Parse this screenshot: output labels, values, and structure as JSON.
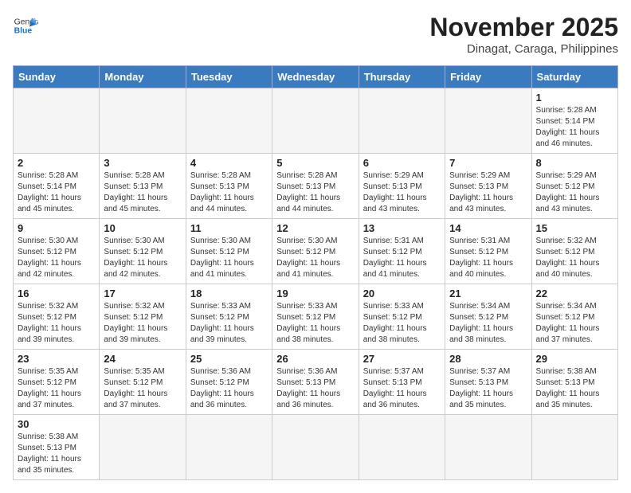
{
  "header": {
    "logo_general": "General",
    "logo_blue": "Blue",
    "month_title": "November 2025",
    "location": "Dinagat, Caraga, Philippines"
  },
  "weekdays": [
    "Sunday",
    "Monday",
    "Tuesday",
    "Wednesday",
    "Thursday",
    "Friday",
    "Saturday"
  ],
  "weeks": [
    [
      {
        "day": "",
        "info": ""
      },
      {
        "day": "",
        "info": ""
      },
      {
        "day": "",
        "info": ""
      },
      {
        "day": "",
        "info": ""
      },
      {
        "day": "",
        "info": ""
      },
      {
        "day": "",
        "info": ""
      },
      {
        "day": "1",
        "info": "Sunrise: 5:28 AM\nSunset: 5:14 PM\nDaylight: 11 hours\nand 46 minutes."
      }
    ],
    [
      {
        "day": "2",
        "info": "Sunrise: 5:28 AM\nSunset: 5:14 PM\nDaylight: 11 hours\nand 45 minutes."
      },
      {
        "day": "3",
        "info": "Sunrise: 5:28 AM\nSunset: 5:13 PM\nDaylight: 11 hours\nand 45 minutes."
      },
      {
        "day": "4",
        "info": "Sunrise: 5:28 AM\nSunset: 5:13 PM\nDaylight: 11 hours\nand 44 minutes."
      },
      {
        "day": "5",
        "info": "Sunrise: 5:28 AM\nSunset: 5:13 PM\nDaylight: 11 hours\nand 44 minutes."
      },
      {
        "day": "6",
        "info": "Sunrise: 5:29 AM\nSunset: 5:13 PM\nDaylight: 11 hours\nand 43 minutes."
      },
      {
        "day": "7",
        "info": "Sunrise: 5:29 AM\nSunset: 5:13 PM\nDaylight: 11 hours\nand 43 minutes."
      },
      {
        "day": "8",
        "info": "Sunrise: 5:29 AM\nSunset: 5:12 PM\nDaylight: 11 hours\nand 43 minutes."
      }
    ],
    [
      {
        "day": "9",
        "info": "Sunrise: 5:30 AM\nSunset: 5:12 PM\nDaylight: 11 hours\nand 42 minutes."
      },
      {
        "day": "10",
        "info": "Sunrise: 5:30 AM\nSunset: 5:12 PM\nDaylight: 11 hours\nand 42 minutes."
      },
      {
        "day": "11",
        "info": "Sunrise: 5:30 AM\nSunset: 5:12 PM\nDaylight: 11 hours\nand 41 minutes."
      },
      {
        "day": "12",
        "info": "Sunrise: 5:30 AM\nSunset: 5:12 PM\nDaylight: 11 hours\nand 41 minutes."
      },
      {
        "day": "13",
        "info": "Sunrise: 5:31 AM\nSunset: 5:12 PM\nDaylight: 11 hours\nand 41 minutes."
      },
      {
        "day": "14",
        "info": "Sunrise: 5:31 AM\nSunset: 5:12 PM\nDaylight: 11 hours\nand 40 minutes."
      },
      {
        "day": "15",
        "info": "Sunrise: 5:32 AM\nSunset: 5:12 PM\nDaylight: 11 hours\nand 40 minutes."
      }
    ],
    [
      {
        "day": "16",
        "info": "Sunrise: 5:32 AM\nSunset: 5:12 PM\nDaylight: 11 hours\nand 39 minutes."
      },
      {
        "day": "17",
        "info": "Sunrise: 5:32 AM\nSunset: 5:12 PM\nDaylight: 11 hours\nand 39 minutes."
      },
      {
        "day": "18",
        "info": "Sunrise: 5:33 AM\nSunset: 5:12 PM\nDaylight: 11 hours\nand 39 minutes."
      },
      {
        "day": "19",
        "info": "Sunrise: 5:33 AM\nSunset: 5:12 PM\nDaylight: 11 hours\nand 38 minutes."
      },
      {
        "day": "20",
        "info": "Sunrise: 5:33 AM\nSunset: 5:12 PM\nDaylight: 11 hours\nand 38 minutes."
      },
      {
        "day": "21",
        "info": "Sunrise: 5:34 AM\nSunset: 5:12 PM\nDaylight: 11 hours\nand 38 minutes."
      },
      {
        "day": "22",
        "info": "Sunrise: 5:34 AM\nSunset: 5:12 PM\nDaylight: 11 hours\nand 37 minutes."
      }
    ],
    [
      {
        "day": "23",
        "info": "Sunrise: 5:35 AM\nSunset: 5:12 PM\nDaylight: 11 hours\nand 37 minutes."
      },
      {
        "day": "24",
        "info": "Sunrise: 5:35 AM\nSunset: 5:12 PM\nDaylight: 11 hours\nand 37 minutes."
      },
      {
        "day": "25",
        "info": "Sunrise: 5:36 AM\nSunset: 5:12 PM\nDaylight: 11 hours\nand 36 minutes."
      },
      {
        "day": "26",
        "info": "Sunrise: 5:36 AM\nSunset: 5:13 PM\nDaylight: 11 hours\nand 36 minutes."
      },
      {
        "day": "27",
        "info": "Sunrise: 5:37 AM\nSunset: 5:13 PM\nDaylight: 11 hours\nand 36 minutes."
      },
      {
        "day": "28",
        "info": "Sunrise: 5:37 AM\nSunset: 5:13 PM\nDaylight: 11 hours\nand 35 minutes."
      },
      {
        "day": "29",
        "info": "Sunrise: 5:38 AM\nSunset: 5:13 PM\nDaylight: 11 hours\nand 35 minutes."
      }
    ],
    [
      {
        "day": "30",
        "info": "Sunrise: 5:38 AM\nSunset: 5:13 PM\nDaylight: 11 hours\nand 35 minutes."
      },
      {
        "day": "",
        "info": ""
      },
      {
        "day": "",
        "info": ""
      },
      {
        "day": "",
        "info": ""
      },
      {
        "day": "",
        "info": ""
      },
      {
        "day": "",
        "info": ""
      },
      {
        "day": "",
        "info": ""
      }
    ]
  ]
}
